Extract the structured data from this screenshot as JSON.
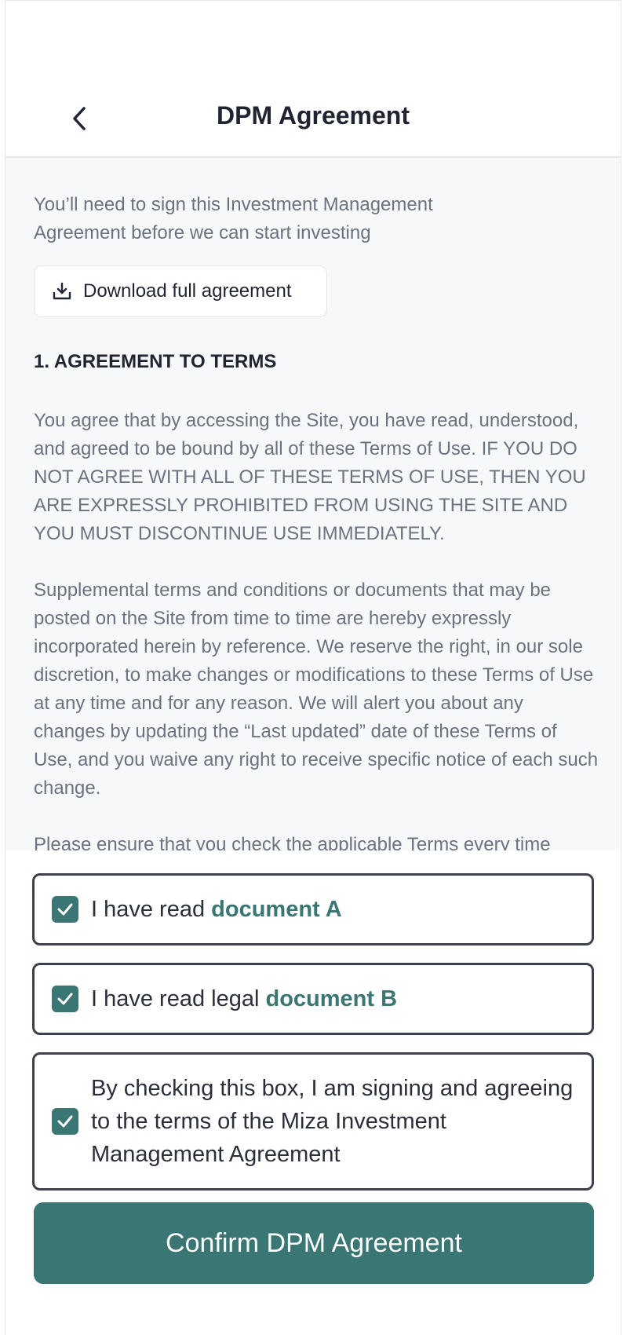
{
  "header": {
    "title": "DPM Agreement",
    "back_icon": "chevron-left-icon"
  },
  "content": {
    "intro": "You’ll need to sign this Investment Management Agreement before we can start investing",
    "download_label": "Download full agreement",
    "download_icon": "download-icon",
    "section_title": "1. AGREEMENT TO TERMS",
    "paragraph_1": "You agree that by accessing the Site, you have read, understood, and agreed to be bound by all of these Terms of Use. IF YOU DO NOT AGREE WITH ALL OF THESE TERMS OF USE, THEN YOU ARE EXPRESSLY PROHIBITED FROM USING THE SITE AND YOU MUST DISCONTINUE USE IMMEDIATELY.",
    "paragraph_2": "Supplemental terms and conditions or documents that may be posted on the Site from time to time are hereby expressly incorporated herein by reference. We reserve the right, in our sole discretion, to make changes or modifications to these Terms of Use at any time and for any reason. We will alert you about any changes by updating the “Last updated” date of these Terms of Use, and you waive any right to receive specific notice of each such change.",
    "paragraph_3": "Please ensure that you check the applicable Terms every time"
  },
  "checkboxes": [
    {
      "prefix": "I have read ",
      "link": "document A",
      "checked": true
    },
    {
      "prefix": "I have read legal ",
      "link": "document B",
      "checked": true
    },
    {
      "prefix": "By checking this box, I am signing and agreeing to the terms of the Miza Investment Management Agreement",
      "link": "",
      "checked": true
    }
  ],
  "confirm_label": "Confirm DPM Agreement",
  "colors": {
    "accent": "#3a7673",
    "text_primary": "#1f2430",
    "text_muted": "#6b7280",
    "content_bg": "#f7f8fa"
  }
}
